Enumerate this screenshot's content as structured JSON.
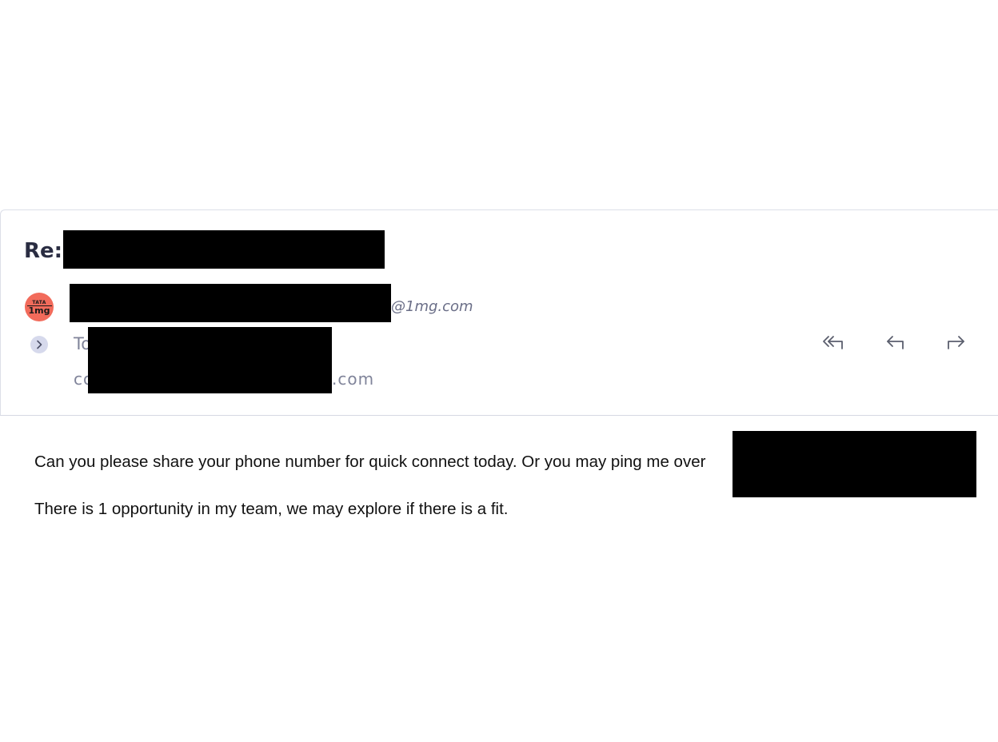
{
  "email": {
    "subject_prefix": "Re:",
    "sender": {
      "avatar_top": "TATA",
      "avatar_bottom": "1mg",
      "email_domain": "@1mg.com"
    },
    "recipients": {
      "to_label": "To",
      "cc_prefix": "co",
      "cc_suffix": ".com"
    },
    "actions": [
      {
        "name": "reply-all",
        "icon": "reply-all-icon"
      },
      {
        "name": "reply",
        "icon": "reply-icon"
      },
      {
        "name": "forward",
        "icon": "forward-icon"
      }
    ],
    "body": {
      "line1": "Can you please share your phone number for quick connect today. Or you may ping me over",
      "line2": "There is 1 opportunity in my team, we may explore if there is a fit."
    }
  },
  "colors": {
    "avatar_bg": "#f26b5b",
    "subject_text": "#2a2d42",
    "meta_text": "#80849a",
    "icon_stroke": "#5b5f6e",
    "divider": "#d6d9e3"
  }
}
